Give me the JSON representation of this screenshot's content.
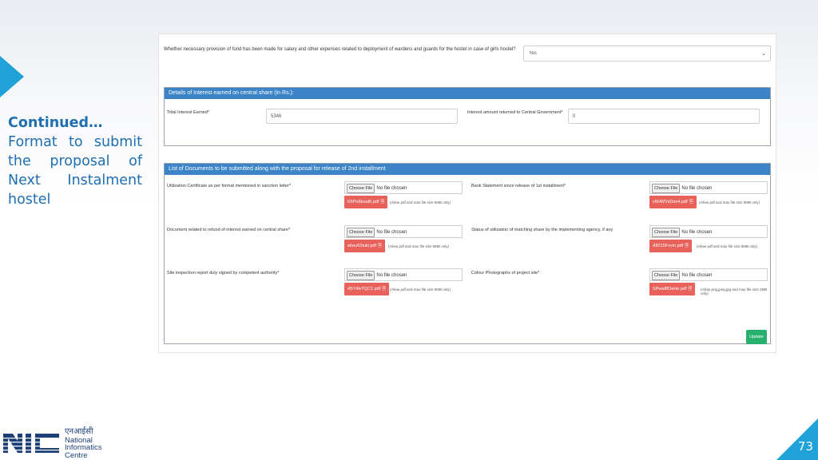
{
  "slide": {
    "heading": "Continued…",
    "lines": [
      "Format to submit",
      "the proposal of",
      "Next    Instalment",
      "hostel"
    ],
    "page_number": "73"
  },
  "logo": {
    "hindi": "एनआईसी",
    "line1": "National",
    "line2": "Informatics",
    "line3": "Centre"
  },
  "form": {
    "question": "Whether necessary provision of fund has been made for salary and other expenses related to deployment of wardens and guards for the hostel in case of girls hostel?",
    "question_value": "Yes",
    "interest_section": {
      "title": "Details of Interest earned on central share (in Rs.):",
      "total_label": "Total Interest Earned*",
      "total_value": "5346",
      "returned_label": "Interest amount returned to Central Government*",
      "returned_value": "0"
    },
    "docs_section": {
      "title": "List of Documents to be submitted along with the proposal for release of 2nd installment",
      "choose_label": "Choose File",
      "no_file": "No file chosen",
      "docs": [
        {
          "label": "Utilization Certificate as per format mentioned in sanction letter*",
          "file": "K6Po6buuf6.pdf",
          "hint": "(Allow pdf and max file size 5MB only)"
        },
        {
          "label": "Bank Statement since release of 1st installment*",
          "file": "v6HWVsDon4.pdf",
          "hint": "(Allow pdf and max file size 5MB only)"
        },
        {
          "label": "Document related to refund of interest earned on central share*",
          "file": "ebou62tuki.pdf",
          "hint": "(Allow pdf and max file size 5MB only)"
        },
        {
          "label": "Status of utilization of matching share by the implementing agency, if any",
          "file": "A8215Fvvin.pdf",
          "hint": "(Allow pdf and max file size 5MB only)"
        },
        {
          "label": "Site inspection report duly signed by competent authority*",
          "file": "4SY4lvTQC1.pdf",
          "hint": "(Allow pdf and max file size 5MB only)"
        },
        {
          "label": "Colour Photographs of project site*",
          "file": "SPwa8fOeHe.pdf",
          "hint": "(Allow png,jpeg,jpg and max file size 2MB only)"
        }
      ]
    },
    "update_label": "Update"
  },
  "colors": {
    "accent": "#1fa2d8",
    "header_blue": "#3b84c7",
    "chip_red": "#e8625b",
    "update_green": "#27b06b",
    "text_blue": "#1f6fb2"
  }
}
